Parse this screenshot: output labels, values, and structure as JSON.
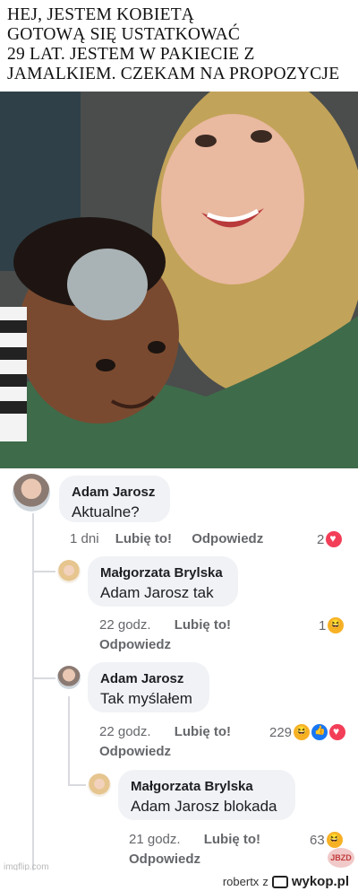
{
  "meme": {
    "caption_lines": [
      "HEJ, JESTEM KOBIETĄ",
      "GOTOWĄ SIĘ USTATKOWAĆ",
      "29 LAT. JESTEM W PAKIECIE Z",
      "JAMALKIEM. CZEKAM NA PROPOZYCJE"
    ]
  },
  "comments": [
    {
      "author": "Adam Jarosz",
      "text": "Aktualne?",
      "time": "1 dni",
      "like": "Lubię to!",
      "reply": "Odpowiedz",
      "reaction_count": "2"
    },
    {
      "author": "Małgorzata Brylska",
      "text": "Adam Jarosz tak",
      "time": "22 godz.",
      "like": "Lubię to!",
      "reply": "Odpowiedz",
      "reaction_count": "1"
    },
    {
      "author": "Adam Jarosz",
      "text": "Tak myślałem",
      "time": "22 godz.",
      "like": "Lubię to!",
      "reply": "Odpowiedz",
      "reaction_count": "229"
    },
    {
      "author": "Małgorzata Brylska",
      "text": "Adam Jarosz blokada",
      "time": "21 godz.",
      "like": "Lubię to!",
      "reply": "Odpowiedz",
      "reaction_count": "63"
    }
  ],
  "watermarks": {
    "imgflip": "imgflip.com",
    "jbzd": "JBZD"
  },
  "footer": {
    "user": "robertx",
    "connector": "z",
    "brand": "wykop.pl"
  },
  "icons": {
    "heart": "heart-reaction-icon",
    "haha": "haha-reaction-icon",
    "like": "like-reaction-icon"
  },
  "colors": {
    "bubble_bg": "#f0f2f5",
    "heart": "#f33e58",
    "haha": "#f7b125",
    "like": "#1877f2"
  }
}
